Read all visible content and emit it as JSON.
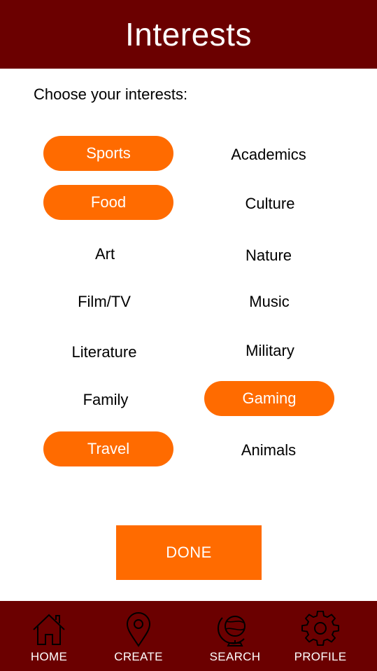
{
  "header": {
    "title": "Interests"
  },
  "prompt": "Choose your interests:",
  "interests": {
    "sports": {
      "label": "Sports",
      "selected": true
    },
    "academics": {
      "label": "Academics",
      "selected": false
    },
    "food": {
      "label": "Food",
      "selected": true
    },
    "culture": {
      "label": "Culture",
      "selected": false
    },
    "art": {
      "label": "Art",
      "selected": false
    },
    "nature": {
      "label": "Nature",
      "selected": false
    },
    "film_tv": {
      "label": "Film/TV",
      "selected": false
    },
    "music": {
      "label": "Music",
      "selected": false
    },
    "literature": {
      "label": "Literature",
      "selected": false
    },
    "military": {
      "label": "Military",
      "selected": false
    },
    "family": {
      "label": "Family",
      "selected": false
    },
    "gaming": {
      "label": "Gaming",
      "selected": true
    },
    "travel": {
      "label": "Travel",
      "selected": true
    },
    "animals": {
      "label": "Animals",
      "selected": false
    }
  },
  "done_label": "DONE",
  "nav": {
    "home": {
      "label": "HOME",
      "icon": "home-icon"
    },
    "create": {
      "label": "CREATE",
      "icon": "map-pin-icon"
    },
    "search": {
      "label": "SEARCH",
      "icon": "globe-icon"
    },
    "profile": {
      "label": "PROFILE",
      "icon": "gear-icon"
    }
  },
  "colors": {
    "header_bg": "#6b0000",
    "accent": "#ff6b00",
    "selected_text": "#ffffff"
  }
}
